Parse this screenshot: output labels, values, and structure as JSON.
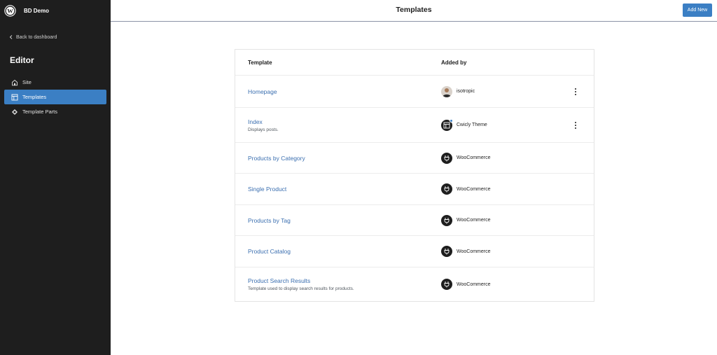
{
  "sidebar": {
    "site_name": "BD Demo",
    "back_label": "Back to dashboard",
    "editor_title": "Editor",
    "items": [
      {
        "label": "Site",
        "icon": "home-icon"
      },
      {
        "label": "Templates",
        "icon": "layout-icon",
        "active": true
      },
      {
        "label": "Template Parts",
        "icon": "symbol-icon"
      }
    ]
  },
  "header": {
    "title": "Templates",
    "add_new_label": "Add New"
  },
  "table": {
    "columns": [
      "Template",
      "Added by"
    ],
    "rows": [
      {
        "name": "Homepage",
        "description": "",
        "added_by": "isotropic",
        "avatar": "person-avatar",
        "has_actions": true
      },
      {
        "name": "Index",
        "description": "Displays posts.",
        "added_by": "Cwicly Theme",
        "avatar": "theme-icon",
        "has_actions": true
      },
      {
        "name": "Products by Category",
        "description": "",
        "added_by": "WooCommerce",
        "avatar": "plugin-icon",
        "has_actions": false
      },
      {
        "name": "Single Product",
        "description": "",
        "added_by": "WooCommerce",
        "avatar": "plugin-icon",
        "has_actions": false
      },
      {
        "name": "Products by Tag",
        "description": "",
        "added_by": "WooCommerce",
        "avatar": "plugin-icon",
        "has_actions": false
      },
      {
        "name": "Product Catalog",
        "description": "",
        "added_by": "WooCommerce",
        "avatar": "plugin-icon",
        "has_actions": false
      },
      {
        "name": "Product Search Results",
        "description": "Template used to display search results for products.",
        "added_by": "WooCommerce",
        "avatar": "plugin-icon",
        "has_actions": false
      }
    ]
  },
  "colors": {
    "sidebar_bg": "#1e1e1e",
    "accent": "#3b7fc4",
    "link": "#3b6fb0"
  }
}
